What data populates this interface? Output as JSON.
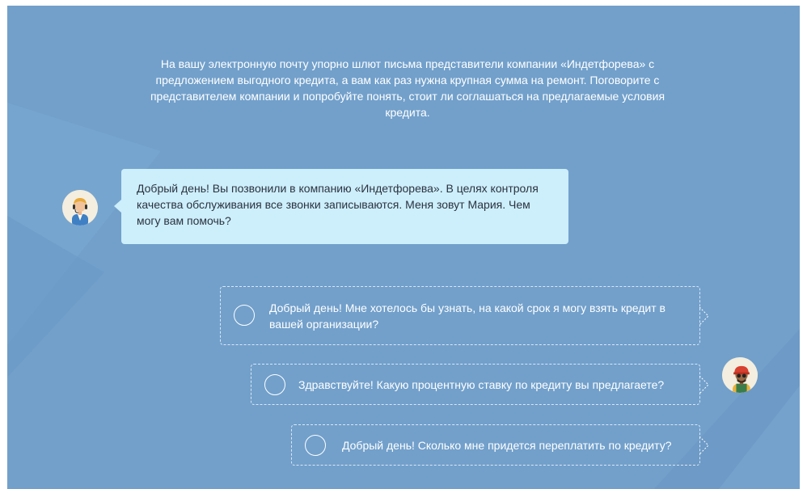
{
  "intro": {
    "text": "На вашу электронную почту упорно шлют письма представители компании «Индетфорева» с предложением выгодного кредита, а вам как раз нужна крупная сумма на ремонт. Поговорите с представителем компании и попробуйте понять, стоит ли соглашаться на предлагаемые условия кредита."
  },
  "bot": {
    "avatar_icon": "operator-avatar-icon",
    "message": "Добрый день! Вы позвонили в компанию «Индетфорева». В целях контроля качества обслуживания все звонки записываются. Меня зовут Мария. Чем могу вам помочь?"
  },
  "user": {
    "avatar_icon": "user-avatar-icon",
    "options": [
      {
        "label": "Добрый день! Мне хотелось бы узнать, на какой срок я могу взять кредит в вашей организации?"
      },
      {
        "label": "Здравствуйте! Какую процентную ставку по кредиту вы предлагаете?"
      },
      {
        "label": "Добрый день! Сколько мне придется переплатить по кредиту?"
      }
    ]
  },
  "colors": {
    "background": "#72a0cb",
    "bot_bubble": "#cdeefb",
    "option_border": "#ffffff"
  }
}
